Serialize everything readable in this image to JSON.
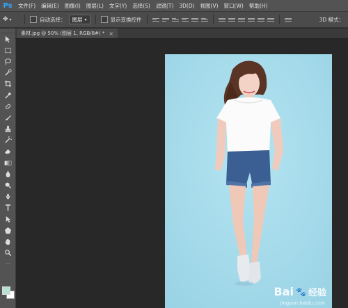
{
  "app": {
    "logo": "Ps"
  },
  "menu": {
    "items": [
      "文件(F)",
      "编辑(E)",
      "图像(I)",
      "图层(L)",
      "文字(Y)",
      "选择(S)",
      "滤镜(T)",
      "3D(D)",
      "视图(V)",
      "窗口(W)",
      "帮助(H)"
    ]
  },
  "options": {
    "auto_select_label": "自动选择：",
    "auto_select_value": "图层",
    "show_transform_label": "显示变换控件",
    "mode_3d_label": "3D 模式："
  },
  "document": {
    "tab_label": "素材.jpg @ 50% (图层 1, RGB/8#) *",
    "close_symbol": "×"
  },
  "watermark": {
    "brand": "Bai",
    "brand_suffix": "经验",
    "site": "jingyan.baidu.com"
  },
  "colors": {
    "foreground": "#b8e0d0",
    "background": "#ffffff",
    "photo_bg": "#a7dceb",
    "accent": "#31a8ff"
  }
}
